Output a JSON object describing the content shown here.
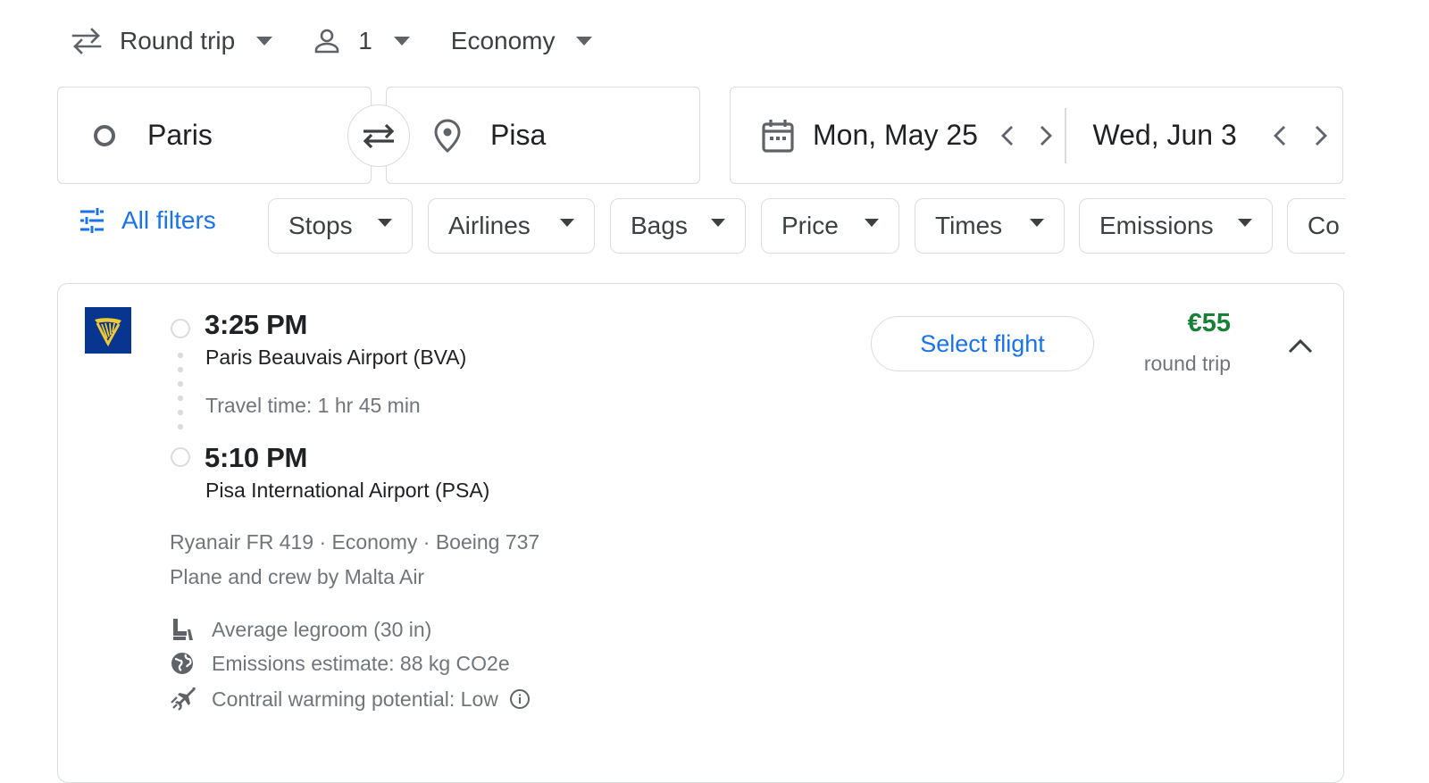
{
  "trip_type": {
    "label": "Round trip",
    "icon": "swap-arrows-icon"
  },
  "passengers": {
    "count": "1",
    "icon": "person-icon"
  },
  "cabin_class": {
    "label": "Economy"
  },
  "search": {
    "origin": "Paris",
    "destination": "Pisa",
    "depart_date": "Mon, May 25",
    "return_date": "Wed, Jun 3"
  },
  "filters": {
    "all_filters_label": "All filters",
    "chips": [
      "Stops",
      "Airlines",
      "Bags",
      "Price",
      "Times",
      "Emissions",
      "Co"
    ]
  },
  "result": {
    "airline_logo": "ryanair-harp-icon",
    "departure_time": "3:25 PM",
    "departure_airport": "Paris Beauvais Airport (BVA)",
    "travel_time": "Travel time: 1 hr 45 min",
    "arrival_time": "5:10 PM",
    "arrival_airport": "Pisa International Airport (PSA)",
    "flight_details": "Ryanair FR 419 · Economy · Boeing 737",
    "operator": "Plane and crew by Malta Air",
    "amenities": [
      {
        "icon": "legroom-seat-icon",
        "text": "Average legroom (30 in)"
      },
      {
        "icon": "globe-icon",
        "text": "Emissions estimate: 88 kg CO2e"
      },
      {
        "icon": "contrail-plane-icon",
        "text": "Contrail warming potential: Low"
      }
    ],
    "select_label": "Select flight",
    "price": "€55",
    "price_note": "round trip"
  },
  "colors": {
    "accent": "#1a73e8",
    "price_green": "#188038",
    "border": "#dadce0",
    "ryanair_blue": "#073590",
    "ryanair_yellow": "#f1c933"
  }
}
